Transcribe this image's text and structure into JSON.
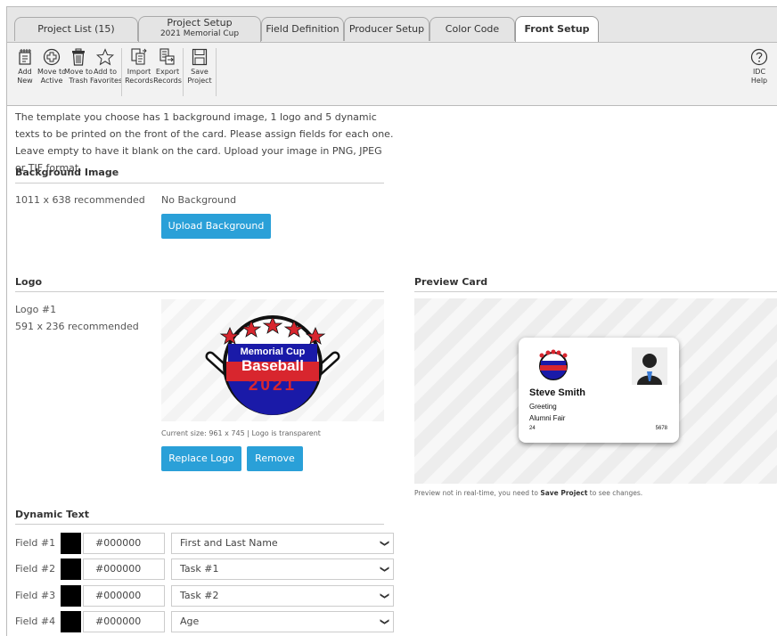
{
  "tabs": [
    {
      "label": "Project List (15)"
    },
    {
      "label": "Project Setup",
      "sub": "2021 Memorial Cup"
    },
    {
      "label": "Field Definition"
    },
    {
      "label": "Producer Setup"
    },
    {
      "label": "Color Code"
    },
    {
      "label": "Front Setup"
    }
  ],
  "toolbar": [
    {
      "l1": "Add",
      "l2": "New",
      "icon": "new-file-icon"
    },
    {
      "l1": "Move to",
      "l2": "Active",
      "icon": "plus-circle-icon"
    },
    {
      "l1": "Move to",
      "l2": "Trash",
      "icon": "trash-icon"
    },
    {
      "l1": "Add to",
      "l2": "Favorites",
      "icon": "star-icon"
    },
    {
      "l1": "Import",
      "l2": "Records",
      "icon": "import-icon"
    },
    {
      "l1": "Export",
      "l2": "Records",
      "icon": "export-icon"
    },
    {
      "l1": "Save",
      "l2": "Project",
      "icon": "save-icon"
    }
  ],
  "help": {
    "l1": "IDC",
    "l2": "Help"
  },
  "intro": "The template you choose has 1 background image, 1 logo and 5 dynamic texts to be printed on the front of the card. Please assign fields for each one. Leave empty to have it blank on the card. Upload your image in PNG, JPEG or TIF format.",
  "background": {
    "heading": "Background Image",
    "recommended": "1011 x 638 recommended",
    "status": "No Background",
    "upload_label": "Upload Background"
  },
  "logo": {
    "heading": "Logo",
    "item_label": "Logo #1",
    "recommended": "591 x 236 recommended",
    "line1": "Memorial Cup",
    "line2": "Baseball",
    "line3": "2021",
    "current_size": "Current size: 961 x 745 | Logo is transparent",
    "replace_label": "Replace Logo",
    "remove_label": "Remove"
  },
  "preview": {
    "heading": "Preview Card",
    "name": "Steve Smith",
    "line1": "Greeting",
    "line2": "Alumni Fair",
    "left_num": "24",
    "right_num": "5678",
    "note_pre": "Preview not in real-time, you need to ",
    "note_bold": "Save Project",
    "note_post": " to see changes."
  },
  "dynamic": {
    "heading": "Dynamic Text",
    "fields": [
      {
        "label": "Field #1",
        "color": "#000000",
        "value": "First and Last Name"
      },
      {
        "label": "Field #2",
        "color": "#000000",
        "value": "Task #1"
      },
      {
        "label": "Field #3",
        "color": "#000000",
        "value": "Task #2"
      },
      {
        "label": "Field #4",
        "color": "#000000",
        "value": "Age"
      }
    ]
  },
  "colors": {
    "accent": "#2aa0d8",
    "logo_blue": "#1a1aa8",
    "logo_red": "#d8262e"
  }
}
